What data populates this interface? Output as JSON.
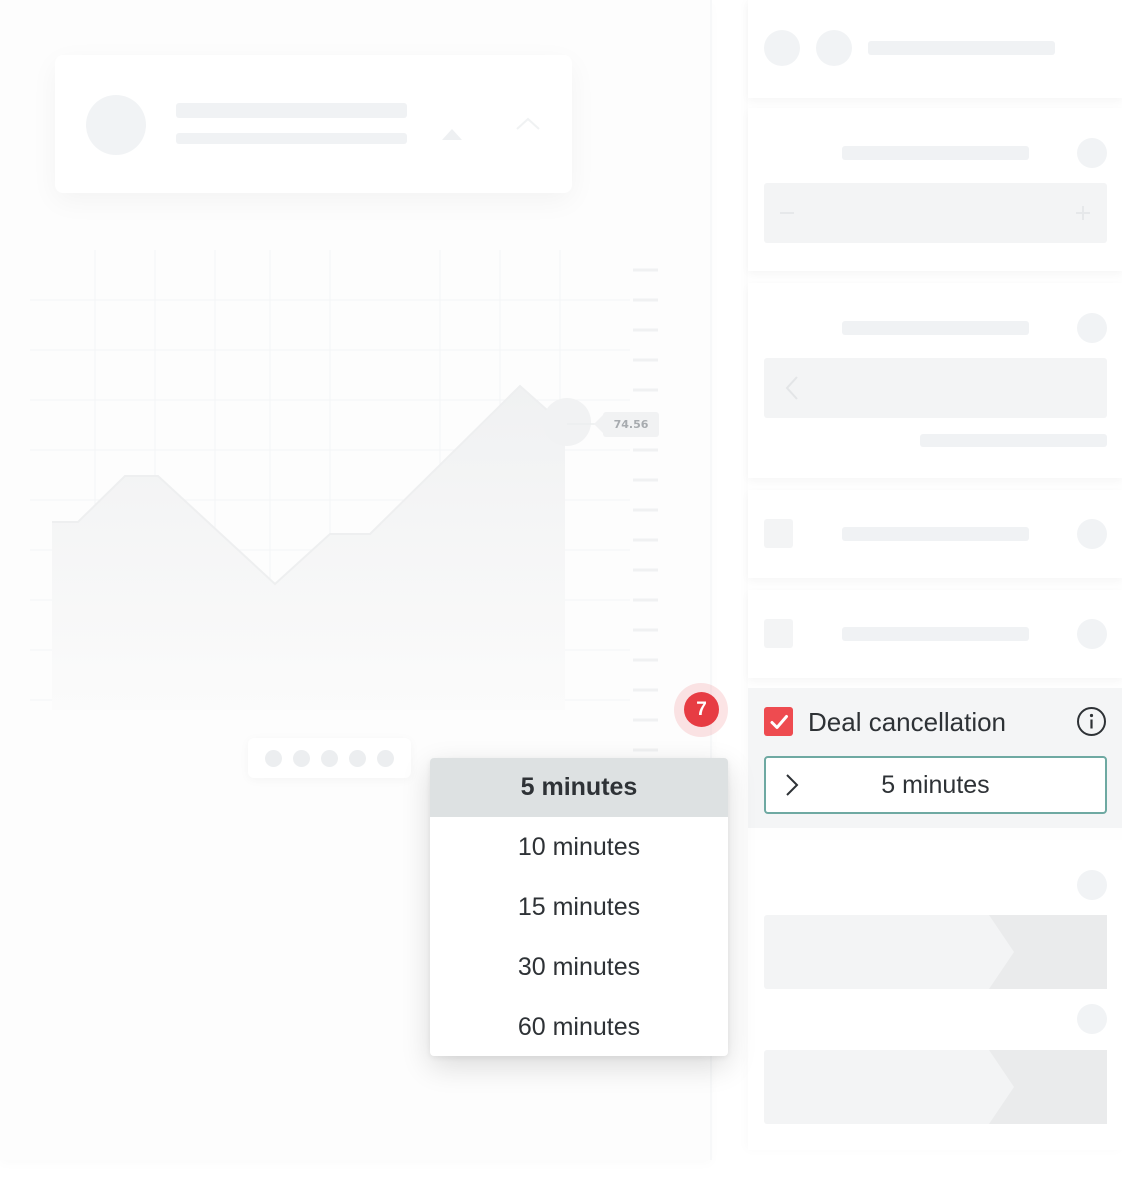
{
  "chart": {
    "price_tag": "74.56"
  },
  "step_badge": {
    "number": "7"
  },
  "setting": {
    "label": "Deal cancellation",
    "checked": true,
    "selected_value": "5 minutes",
    "check_color": "#ee4b50",
    "border_color": "#6ea9a2"
  },
  "dropdown": {
    "options": [
      {
        "label": "5 minutes",
        "selected": true
      },
      {
        "label": "10 minutes",
        "selected": false
      },
      {
        "label": "15 minutes",
        "selected": false
      },
      {
        "label": "30 minutes",
        "selected": false
      },
      {
        "label": "60 minutes",
        "selected": false
      }
    ]
  },
  "icons": {
    "checkbox": "check-icon",
    "info": "info-icon",
    "select_toggle": "chevron-right-icon",
    "arrow_control": "chevron-left-icon"
  }
}
